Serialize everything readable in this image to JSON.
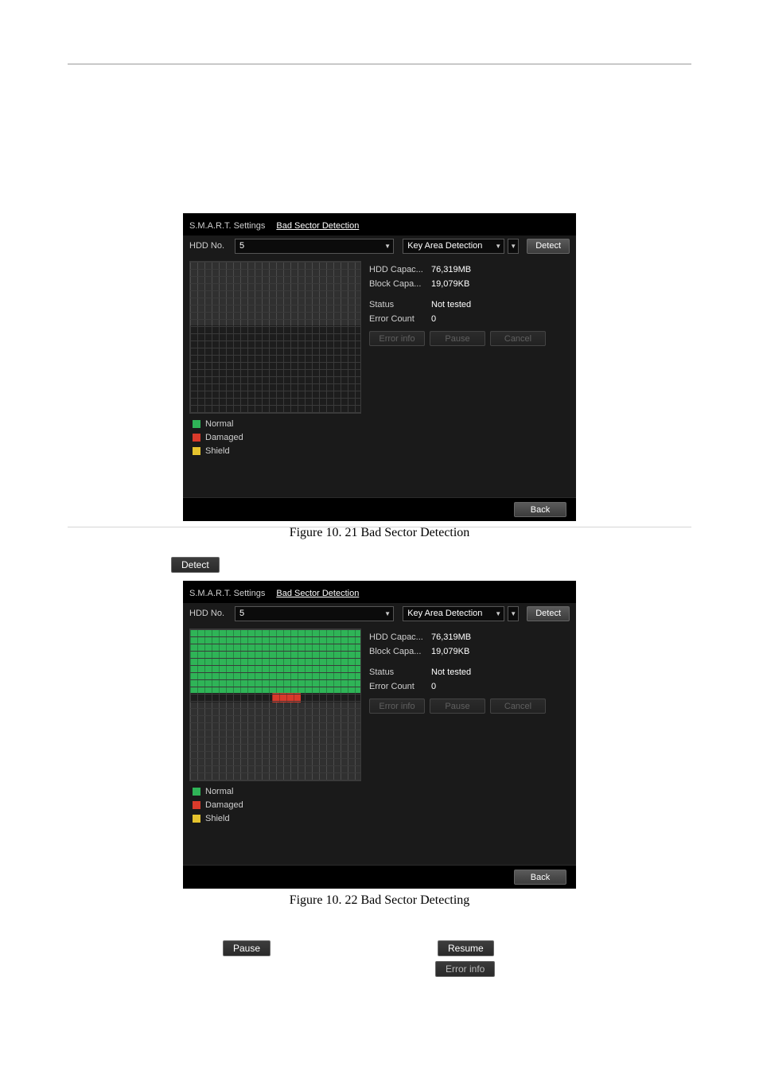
{
  "tabs": {
    "smart": "S.M.A.R.T. Settings",
    "bad": "Bad Sector Detection"
  },
  "hdd_label": "HDD No.",
  "hdd_value": "5",
  "key_area": "Key Area Detection",
  "detect": "Detect",
  "info": {
    "hdd_cap_k": "HDD Capac...",
    "hdd_cap_v": "76,319MB",
    "block_cap_k": "Block Capa...",
    "block_cap_v": "19,079KB",
    "status_k": "Status",
    "status_v": "Not tested",
    "err_k": "Error Count",
    "err_v": "0"
  },
  "btns": {
    "error_info": "Error info",
    "pause": "Pause",
    "cancel": "Cancel",
    "back": "Back",
    "resume": "Resume"
  },
  "legend": {
    "normal": "Normal",
    "damaged": "Damaged",
    "shield": "Shield"
  },
  "caption1": "Figure 10. 21 Bad Sector Detection",
  "caption2": "Figure 10. 22 Bad Sector Detecting"
}
